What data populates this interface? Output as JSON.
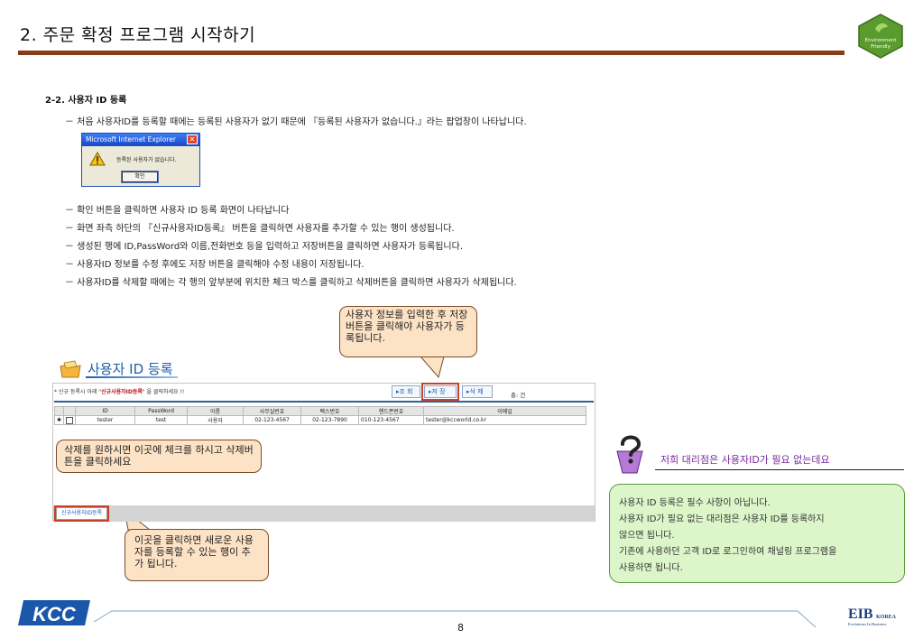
{
  "header": {
    "title": "2. 주문 확정 프로그램 시작하기",
    "badge_line1": "Environment",
    "badge_line2": "Friendly"
  },
  "section": {
    "heading": "2-2. 사용자 ID 등록",
    "bullets": [
      "－ 처음 사용자ID를 등록할 때에는 등록된 사용자가 없기 때문에 『등록된 사용자가 없습니다.』라는 팝업창이 나타납니다.",
      "－ 확인 버튼을 클릭하면 사용자 ID 등록 화면이 나타납니다",
      "－ 화면 좌측 하단의 『신규사용자ID등록』 버튼을 클릭하면 사용자를 추가할 수 있는 행이 생성됩니다.",
      "－ 생성된 행에 ID,PassWord와 이름,전화번호 등을 입력하고 저장버튼을 클릭하면 사용자가 등록됩니다.",
      "－ 사용자ID 정보를 수정 후에도 저장 버튼을 클릭해야 수정 내용이 저장됩니다.",
      "－ 사용자ID를 삭제할 때에는 각 행의 앞부분에 위치한 체크 박스를 클릭하고 삭제버튼을 클릭하면 사용자가 삭제됩니다."
    ]
  },
  "popup": {
    "title": "Microsoft Internet Explorer",
    "close": "✕",
    "message": "등록된 사용자가 없습니다.",
    "ok_label": "확인"
  },
  "callouts": {
    "save": "사용자 정보를 입력한 후 저장버튼을 클릭해야 사용자가 등록됩니다.",
    "delete": "삭제를 원하시면 이곳에 체크를 하시고 삭제버튼을 클릭하세요",
    "newuser": "이곳을 클릭하면 새로운 사용자를 등록할 수 있는 행이 추가 됩니다."
  },
  "window": {
    "title": "사용자 ID 등록",
    "info_prefix": "* 신규 등록시 아래 \"",
    "info_highlight": "신규사용자ID등록",
    "info_suffix": "\" 을 클릭하세요 !!",
    "buttons": {
      "search": "▸조 회",
      "save": "▸저 장",
      "delete": "▸삭 제"
    },
    "total": "총: 건",
    "columns": [
      "",
      "",
      "ID",
      "PassWord",
      "이름",
      "사무실번호",
      "팩스번호",
      "핸드폰번호",
      "이메일"
    ],
    "rows": [
      {
        "marker": "✱",
        "id": "tester",
        "password": "test",
        "name": "사용자",
        "office": "02-123-4567",
        "fax": "02-123-7890",
        "mobile": "010-123-4567",
        "email": "tester@kccworld.co.kr"
      }
    ],
    "newuser_button": "신규사용자ID등록"
  },
  "side": {
    "question": "저희 대리점은 사용자ID가 필요 없는데요",
    "info_lines": [
      "사용자 ID 등록은 필수 사항이 아닙니다.",
      "사용자 ID가 필요 없는 대리점은 사용자 ID를 등록하지",
      "않으면 됩니다.",
      "기존에 사용하던 고객 ID로 로그인하여 채널링 프로그램을",
      "사용하면 됩니다."
    ]
  },
  "footer": {
    "page": "8",
    "logo_left": "KCC",
    "logo_right": "EIB",
    "logo_right_sub": "KOREA",
    "logo_right_tag": "Evolutions In Business"
  },
  "colors": {
    "title_rule": "#8b3a16",
    "callout_fill": "#fde3c6",
    "info_fill": "#dcf5c9",
    "question_text": "#7a2a9e",
    "window_title": "#1f5ea8"
  }
}
